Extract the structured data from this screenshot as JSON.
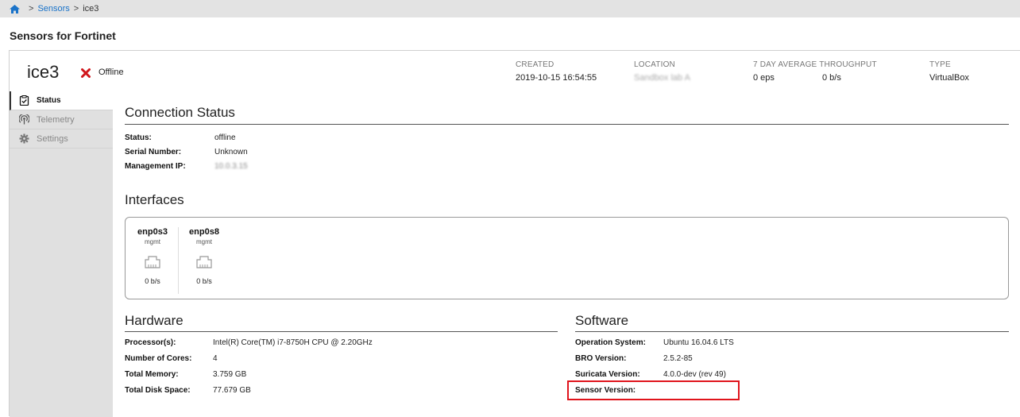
{
  "breadcrumb": {
    "sensors": "Sensors",
    "current": "ice3"
  },
  "page_title": "Sensors for Fortinet",
  "sensor": {
    "name": "ice3",
    "status": "Offline"
  },
  "meta": {
    "created_label": "CREATED",
    "created_value": "2019-10-15 16:54:55",
    "location_label": "LOCATION",
    "location_value": "Sandbox lab A",
    "throughput_label": "7 DAY AVERAGE THROUGHPUT",
    "throughput_eps": "0 eps",
    "throughput_bps": "0 b/s",
    "type_label": "TYPE",
    "type_value": "VirtualBox"
  },
  "sidebar": {
    "items": [
      {
        "label": "Status",
        "icon": "clipboard-check-icon"
      },
      {
        "label": "Telemetry",
        "icon": "broadcast-icon"
      },
      {
        "label": "Settings",
        "icon": "gear-icon"
      }
    ]
  },
  "connection": {
    "title": "Connection Status",
    "status_label": "Status:",
    "status_value": "offline",
    "serial_label": "Serial Number:",
    "serial_value": "Unknown",
    "ip_label": "Management IP:",
    "ip_value": "10.0.3.15"
  },
  "interfaces": {
    "title": "Interfaces",
    "items": [
      {
        "name": "enp0s3",
        "role": "mgmt",
        "rate": "0 b/s"
      },
      {
        "name": "enp0s8",
        "role": "mgmt",
        "rate": "0 b/s"
      }
    ]
  },
  "hardware": {
    "title": "Hardware",
    "processor_label": "Processor(s):",
    "processor_value": "Intel(R) Core(TM) i7-8750H CPU @ 2.20GHz",
    "cores_label": "Number of Cores:",
    "cores_value": "4",
    "memory_label": "Total Memory:",
    "memory_value": "3.759 GB",
    "disk_label": "Total Disk Space:",
    "disk_value": "77.679 GB"
  },
  "software": {
    "title": "Software",
    "os_label": "Operation System:",
    "os_value": "Ubuntu 16.04.6 LTS",
    "bro_label": "BRO Version:",
    "bro_value": "2.5.2-85",
    "suricata_label": "Suricata Version:",
    "suricata_value": "4.0.0-dev (rev 49)",
    "sensor_label": "Sensor Version:",
    "sensor_value": ""
  },
  "colors": {
    "link": "#1a73c9",
    "offline_x": "#d0161c",
    "highlight": "#e0141c"
  }
}
